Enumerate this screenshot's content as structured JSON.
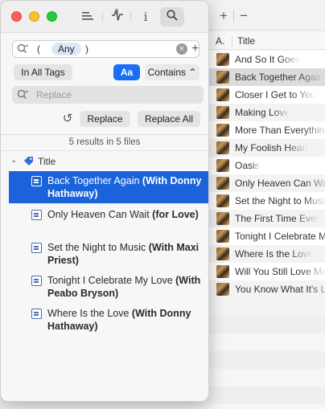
{
  "toolbar": {
    "add": "+",
    "remove": "−",
    "info": "i"
  },
  "song_list": {
    "col_a": "A.",
    "col_title": "Title",
    "songs": [
      "And So It Goes",
      "Back Together Again",
      "Closer I Get to You",
      "Making Love",
      "More Than Everything",
      "My Foolish Heart",
      "Oasis",
      "Only Heaven Can Wait",
      "Set the Night to Music",
      "The First Time Ever",
      "Tonight I Celebrate My Love",
      "Where Is the Love",
      "Will You Still Love Me",
      "You Know What It's Like"
    ]
  },
  "search": {
    "open_paren": "(",
    "token": "Any",
    "close_paren": ")",
    "clear": "×",
    "add": "+"
  },
  "filters": {
    "in_all_tags": "In All Tags",
    "case": "Aa",
    "contains": "Contains ⌃"
  },
  "replace": {
    "placeholder": "Replace",
    "undo": "↺",
    "replace_label": "Replace",
    "replace_all_label": "Replace All"
  },
  "results": {
    "summary": "5 results in 5 files",
    "group_label": "Title",
    "items": [
      {
        "normal": "Back Together Again ",
        "bold": "(With Donny Hathaway)"
      },
      {
        "normal": "Only Heaven Can Wait ",
        "bold": "(for Love)"
      },
      {
        "normal": "Set the Night to Music ",
        "bold": "(With Maxi Priest)"
      },
      {
        "normal": "Tonight I Celebrate My Love ",
        "bold": "(With Peabo Bryson)"
      },
      {
        "normal": "Where Is the Love ",
        "bold": "(With Donny Hathaway)"
      }
    ]
  }
}
